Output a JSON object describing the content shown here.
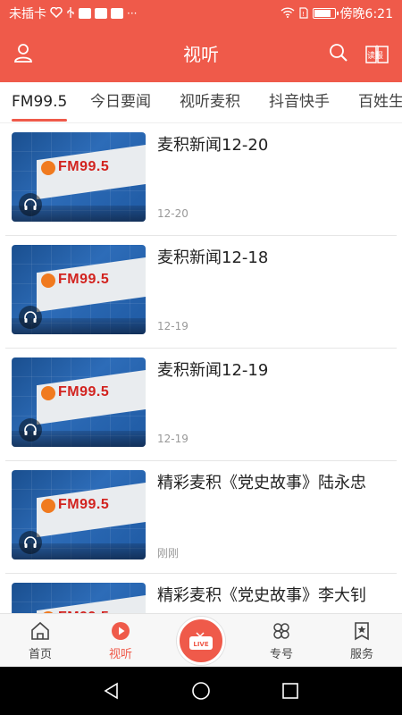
{
  "status_bar": {
    "carrier": "未插卡",
    "left_icons": [
      "heart-icon",
      "usb-icon",
      "app-badge-icon",
      "app-badge-icon",
      "app-badge-icon",
      "more-icon"
    ],
    "right_icons": [
      "wifi-icon",
      "sim-icon",
      "battery-icon"
    ],
    "battery_level": 0.85,
    "time": "傍晚6:21"
  },
  "header": {
    "title": "视听",
    "left_icon": "user-icon",
    "right_icons": [
      "search-icon",
      "newspaper-read-icon"
    ],
    "read_label": "读报",
    "background": "#ef5a4a"
  },
  "tabs": {
    "items": [
      {
        "label": "FM99.5",
        "active": true
      },
      {
        "label": "今日要闻",
        "active": false
      },
      {
        "label": "视听麦积",
        "active": false
      },
      {
        "label": "抖音快手",
        "active": false
      },
      {
        "label": "百姓生",
        "active": false
      }
    ],
    "accent": "#ef5a4a"
  },
  "list": {
    "thumb_logo": "FM99.5",
    "items": [
      {
        "title": "麦积新闻12-20",
        "time": "12-20"
      },
      {
        "title": "麦积新闻12-18",
        "time": "12-19"
      },
      {
        "title": "麦积新闻12-19",
        "time": "12-19"
      },
      {
        "title": "精彩麦积《党史故事》陆永忠",
        "time": "刚刚"
      },
      {
        "title": "精彩麦积《党史故事》李大钊",
        "time": ""
      }
    ]
  },
  "bottom_nav": {
    "items": [
      {
        "label": "首页",
        "icon": "home-icon",
        "active": false
      },
      {
        "label": "视听",
        "icon": "play-circle-icon",
        "active": true
      },
      {
        "label": "专号",
        "icon": "flower-icon",
        "active": false
      },
      {
        "label": "服务",
        "icon": "bookmark-star-icon",
        "active": false
      }
    ],
    "live_label": "LIVE",
    "accent": "#ef5a4a"
  },
  "system_nav": {
    "icons": [
      "back-triangle-icon",
      "home-circle-icon",
      "recents-square-icon"
    ]
  }
}
